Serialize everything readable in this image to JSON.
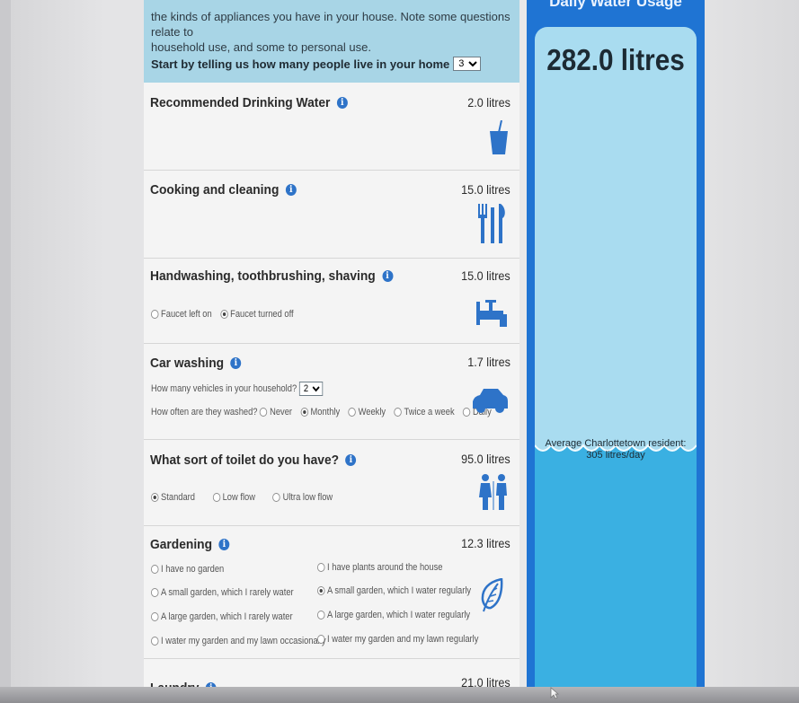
{
  "intro": {
    "line1": "the kinds of appliances you have in your house. Note some questions relate to",
    "line2": "household use, and some to personal use.",
    "people_prompt": "Start by telling us how many people live in your home",
    "people_value": "3"
  },
  "sections": {
    "drinking": {
      "title": "Recommended Drinking Water",
      "amount": "2.0 litres",
      "icon": "cup-icon"
    },
    "cooking": {
      "title": "Cooking and cleaning",
      "amount": "15.0 litres",
      "icon": "utensils-icon"
    },
    "handwashing": {
      "title": "Handwashing, toothbrushing, shaving",
      "amount": "15.0 litres",
      "icon": "faucet-icon",
      "options": [
        "Faucet left on",
        "Faucet turned off"
      ],
      "selected": "Faucet turned off"
    },
    "car": {
      "title": "Car washing",
      "amount": "1.7 litres",
      "icon": "car-icon",
      "vehicles_prompt": "How many vehicles in your household?",
      "vehicles_value": "2",
      "freq_prompt": "How often are they washed?",
      "options": [
        "Never",
        "Monthly",
        "Weekly",
        "Twice a week",
        "Daily"
      ],
      "selected": "Monthly"
    },
    "toilet": {
      "title": "What sort of toilet do you have?",
      "amount": "95.0 litres",
      "icon": "restroom-icon",
      "options": [
        "Standard",
        "Low flow",
        "Ultra low flow"
      ],
      "selected": "Standard"
    },
    "gardening": {
      "title": "Gardening",
      "amount": "12.3 litres",
      "icon": "leaf-icon",
      "options": [
        "I have no garden",
        "I have plants around the house",
        "A small garden, which I rarely water",
        "A small garden, which I water regularly",
        "A large garden, which I rarely water",
        "A large garden, which I water regularly",
        "I water my garden and my lawn occasionally",
        "I water my garden and my lawn regularly"
      ],
      "selected": "A small garden, which I water regularly"
    },
    "laundry": {
      "title": "Laundry",
      "amount": "21.0 litres"
    }
  },
  "sidebar": {
    "header": "Daily Water Usage",
    "usage": "282.0 litres",
    "avg_line1": "Average Charlottetown resident:",
    "avg_line2": "305 litres/day"
  },
  "colors": {
    "accent": "#2e73c8",
    "sidebar": "#1f74d3",
    "meter": "#a9dcf0",
    "water": "#3ab0e2",
    "intro_bg": "#a8d5e6"
  }
}
